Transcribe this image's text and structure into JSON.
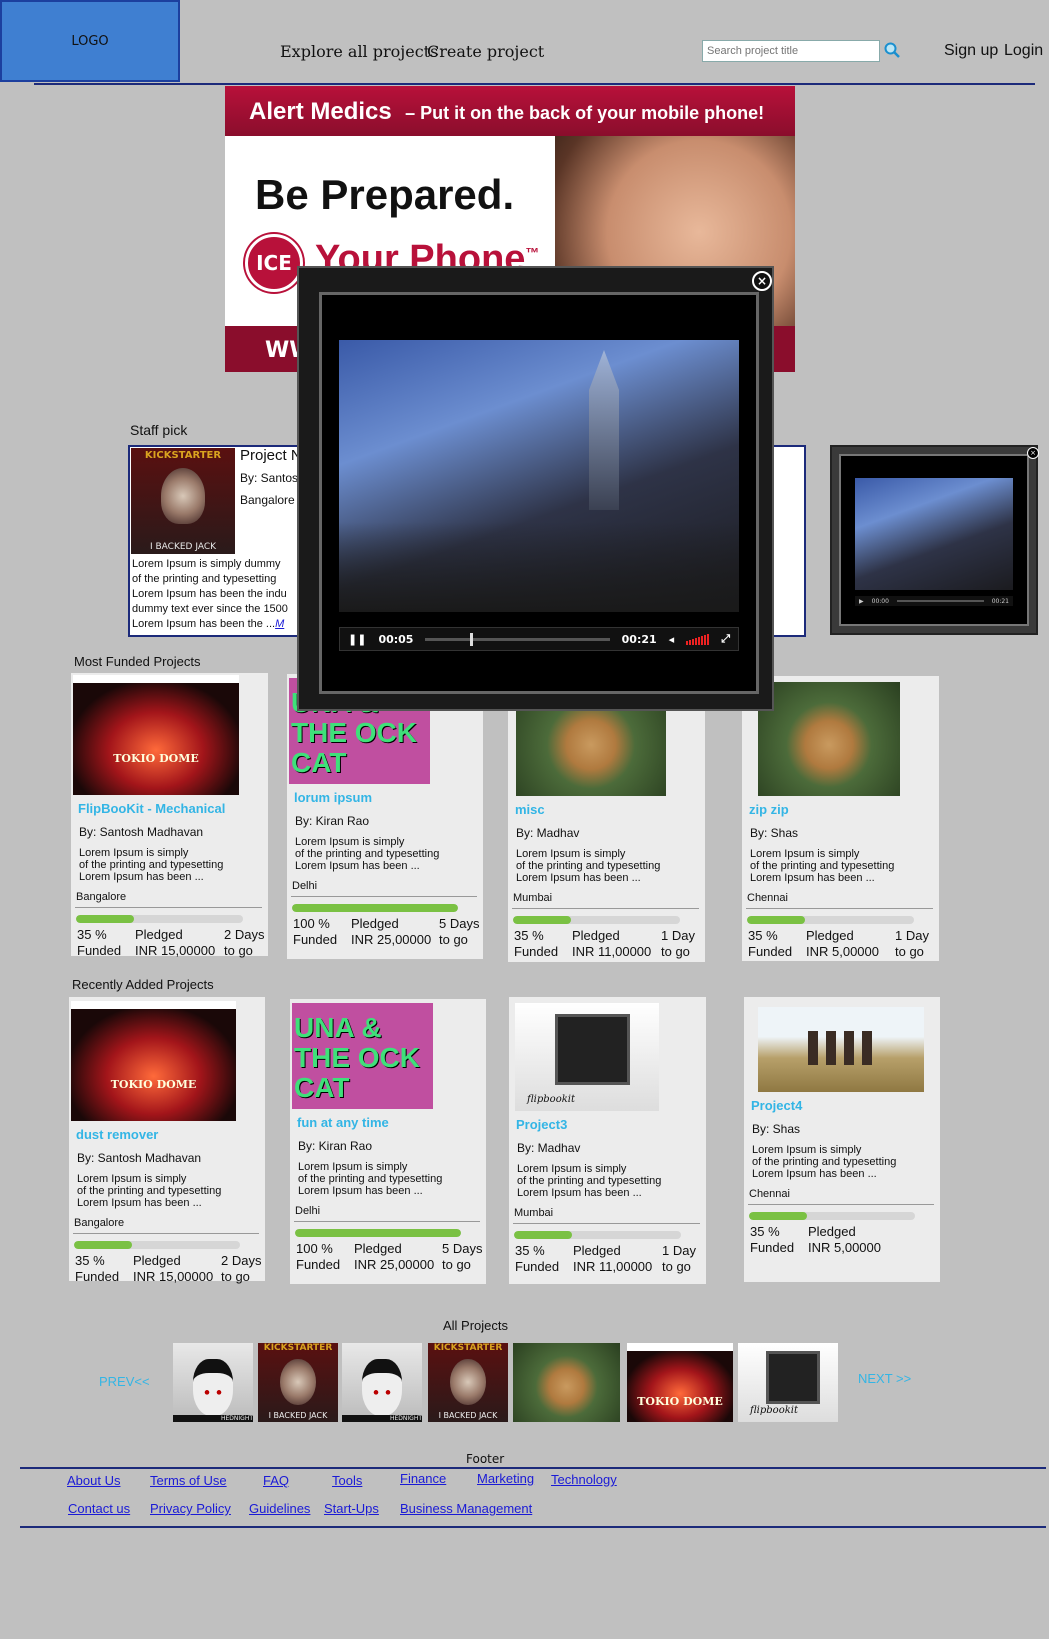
{
  "header": {
    "logo": "LOGO",
    "nav": [
      "Explore all projects",
      "Create project"
    ],
    "search_placeholder": "Search project title",
    "signup": "Sign up",
    "login": "Login"
  },
  "banner": {
    "headline": "Alert Medics",
    "tagline": "– Put it on the back of your mobile phone!",
    "be_prepared": "Be Prepared.",
    "ice": "ICE",
    "your_phone": "Your Phone",
    "tm": "™",
    "url_frag": "WW"
  },
  "staff_pick": {
    "section_title": "Staff pick",
    "thumb_top": "KICKSTARTER",
    "thumb_bottom": "I BACKED JACK",
    "project_name": "Project N",
    "by": "By: Santos",
    "city": "Bangalore",
    "desc": [
      "Lorem Ipsum is simply dummy",
      "of the printing and typesetting",
      "Lorem Ipsum has been the indu",
      "dummy text ever since the 1500",
      "Lorem Ipsum has been the ..."
    ],
    "more": "M"
  },
  "video_popup": {
    "close": "×",
    "elapsed": "00:05",
    "duration": "00:21",
    "progress": 0.24
  },
  "mini_video": {
    "elapsed": "00:00",
    "duration": "00:21"
  },
  "most_funded": {
    "section_title": "Most Funded Projects",
    "cards": [
      {
        "title": "FlipBooKit - Mechanical",
        "by": "By: Santosh Madhavan",
        "desc": [
          "Lorem Ipsum is simply",
          "of the printing and typesetting",
          "Lorem Ipsum has been ..."
        ],
        "city": "Bangalore",
        "pct": "35 %",
        "pct_label": "Funded",
        "pledged_label": "Pledged",
        "pledged": "INR 15,00000",
        "days": "2 Days",
        "days_label": "to go",
        "fill": 0.35,
        "thumb": "tokio-dome",
        "thumb_text": "TOKIO DOME"
      },
      {
        "title": "lorum ipsum",
        "by": "By: Kiran Rao",
        "desc": [
          "Lorem Ipsum is simply",
          "of the printing and typesetting",
          "Lorem Ipsum has been ..."
        ],
        "city": "Delhi",
        "pct": "100 %",
        "pct_label": "Funded",
        "pledged_label": "Pledged",
        "pledged": "INR 25,00000",
        "days": "5 Days",
        "days_label": "to go",
        "fill": 1.0,
        "thumb": "luna-rock-cat",
        "thumb_text": "UNA & THE OCK CAT"
      },
      {
        "title": "misc",
        "by": "By: Madhav",
        "desc": [
          "Lorem Ipsum is simply",
          "of the printing and typesetting",
          "Lorem Ipsum has been ..."
        ],
        "city": "Mumbai",
        "pct": "35 %",
        "pct_label": "Funded",
        "pledged_label": "Pledged",
        "pledged": "INR 11,00000",
        "days": "1 Day",
        "days_label": "to go",
        "fill": 0.35,
        "thumb": "cookies",
        "thumb_text": ""
      },
      {
        "title": "zip zip",
        "by": "By: Shas",
        "desc": [
          "Lorem Ipsum is simply",
          "of the printing and typesetting",
          "Lorem Ipsum has been ..."
        ],
        "city": "Chennai",
        "pct": "35 %",
        "pct_label": "Funded",
        "pledged_label": "Pledged",
        "pledged": "INR 5,00000",
        "days": "1 Day",
        "days_label": "to go",
        "fill": 0.35,
        "thumb": "cookies",
        "thumb_text": ""
      }
    ]
  },
  "recent": {
    "section_title": "Recently Added Projects",
    "cards": [
      {
        "title": "dust remover",
        "by": "By: Santosh Madhavan",
        "desc": [
          "Lorem Ipsum is simply",
          "of the printing and typesetting",
          "Lorem Ipsum has been ..."
        ],
        "city": "Bangalore",
        "pct": "35 %",
        "pct_label": "Funded",
        "pledged_label": "Pledged",
        "pledged": "INR 15,00000",
        "days": "2 Days",
        "days_label": "to go",
        "fill": 0.35,
        "thumb": "tokio-dome",
        "thumb_text": "TOKIO DOME"
      },
      {
        "title": "fun at any time",
        "by": "By: Kiran Rao",
        "desc": [
          "Lorem Ipsum is simply",
          "of the printing and typesetting",
          "Lorem Ipsum has been ..."
        ],
        "city": "Delhi",
        "pct": "100 %",
        "pct_label": "Funded",
        "pledged_label": "Pledged",
        "pledged": "INR 25,00000",
        "days": "5 Days",
        "days_label": "to go",
        "fill": 1.0,
        "thumb": "luna-rock-cat",
        "thumb_text": "UNA & THE OCK CAT"
      },
      {
        "title": "Project3",
        "by": "By: Madhav",
        "desc": [
          "Lorem Ipsum is simply",
          "of the printing and typesetting",
          "Lorem Ipsum has been ..."
        ],
        "city": "Mumbai",
        "pct": "35 %",
        "pct_label": "Funded",
        "pledged_label": "Pledged",
        "pledged": "INR 11,00000",
        "days": "1 Day",
        "days_label": "to go",
        "fill": 0.35,
        "thumb": "flipbookit",
        "thumb_text": "flipbookit"
      },
      {
        "title": "Project4",
        "by": "By: Shas",
        "desc": [
          "Lorem Ipsum is simply",
          "of the printing and typesetting",
          "Lorem Ipsum has been ..."
        ],
        "city": "Chennai",
        "pct": "35 %",
        "pct_label": "Funded",
        "pledged_label": "Pledged",
        "pledged": "INR 5,00000",
        "days": "",
        "days_label": "",
        "fill": 0.35,
        "thumb": "wheat-field",
        "thumb_text": ""
      }
    ]
  },
  "all_projects": {
    "section_title": "All Projects",
    "prev": "PREV<<",
    "next": "NEXT >>",
    "thumbs": [
      {
        "kind": "anime",
        "caption": "HEDNIGHT"
      },
      {
        "kind": "kickstarter",
        "caption": "I BACKED JACK"
      },
      {
        "kind": "anime",
        "caption": "HEDNIGHT"
      },
      {
        "kind": "kickstarter",
        "caption": "I BACKED JACK"
      },
      {
        "kind": "cookies",
        "caption": ""
      },
      {
        "kind": "tokio-dome",
        "caption": "TOKIO DOME"
      },
      {
        "kind": "flipbookit",
        "caption": "flipbookit"
      }
    ]
  },
  "footer": {
    "title": "Footer",
    "row1": [
      "About Us",
      "Terms of Use",
      "FAQ",
      "Tools",
      "Finance",
      "Marketing",
      "Technology"
    ],
    "row2": [
      "Contact us",
      "Privacy Policy",
      "Guidelines",
      "Start-Ups",
      "Business Management"
    ]
  },
  "colors": {
    "page_bg": "#c0c0c0",
    "logo_bg": "#3f7fd1",
    "accent_link": "#33b5e5",
    "progress": "#7ac143",
    "footer_link": "#1a1ad6",
    "rule": "#1c2a7a"
  }
}
